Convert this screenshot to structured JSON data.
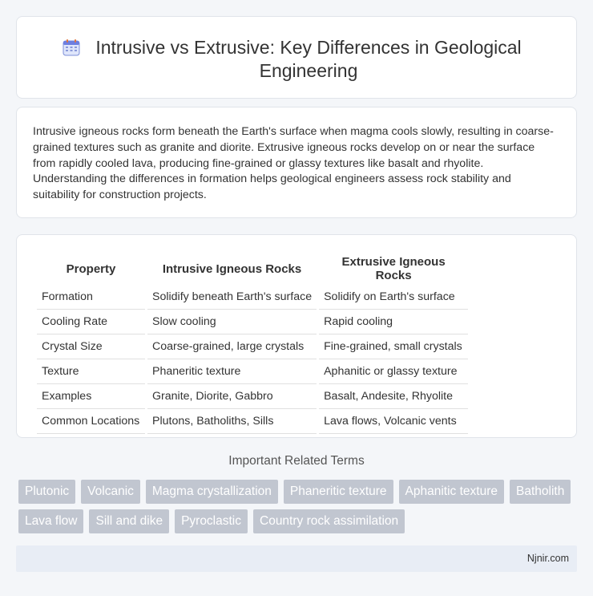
{
  "header": {
    "title": "Intrusive vs Extrusive: Key Differences in Geological Engineering",
    "icon": "calendar-icon"
  },
  "intro": {
    "text": "Intrusive igneous rocks form beneath the Earth's surface when magma cools slowly, resulting in coarse-grained textures such as granite and diorite. Extrusive igneous rocks develop on or near the surface from rapidly cooled lava, producing fine-grained or glassy textures like basalt and rhyolite. Understanding the differences in formation helps geological engineers assess rock stability and suitability for construction projects."
  },
  "table": {
    "headers": [
      "Property",
      "Intrusive Igneous Rocks",
      "Extrusive Igneous Rocks"
    ],
    "rows": [
      [
        "Formation",
        "Solidify beneath Earth's surface",
        "Solidify on Earth's surface"
      ],
      [
        "Cooling Rate",
        "Slow cooling",
        "Rapid cooling"
      ],
      [
        "Crystal Size",
        "Coarse-grained, large crystals",
        "Fine-grained, small crystals"
      ],
      [
        "Texture",
        "Phaneritic texture",
        "Aphanitic or glassy texture"
      ],
      [
        "Examples",
        "Granite, Diorite, Gabbro",
        "Basalt, Andesite, Rhyolite"
      ],
      [
        "Common Locations",
        "Plutons, Batholiths, Sills",
        "Lava flows, Volcanic vents"
      ]
    ]
  },
  "related": {
    "heading": "Important Related Terms",
    "tags": [
      "Plutonic",
      "Volcanic",
      "Magma crystallization",
      "Phaneritic texture",
      "Aphanitic texture",
      "Batholith",
      "Lava flow",
      "Sill and dike",
      "Pyroclastic",
      "Country rock assimilation"
    ]
  },
  "footer": {
    "text": "Njnir.com"
  },
  "colors": {
    "tag_bg": "#c1c6d0",
    "footer_bg": "#e8edf5",
    "page_bg": "#f4f6f9"
  }
}
